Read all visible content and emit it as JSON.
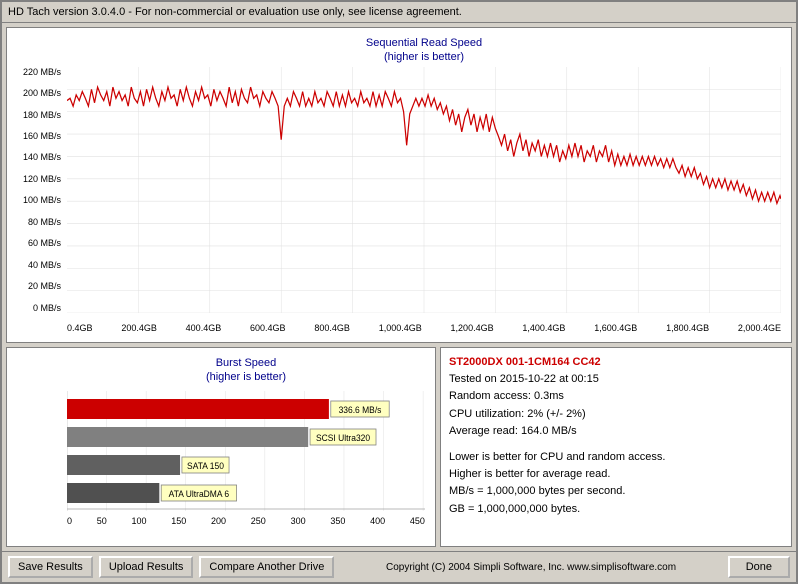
{
  "title_bar": {
    "text": "HD Tach version 3.0.4.0  - For non-commercial or evaluation use only, see license agreement."
  },
  "seq_chart": {
    "title_line1": "Sequential Read Speed",
    "title_line2": "(higher is better)",
    "y_labels": [
      "220 MB/s",
      "200 MB/s",
      "180 MB/s",
      "160 MB/s",
      "140 MB/s",
      "120 MB/s",
      "100 MB/s",
      "80 MB/s",
      "60 MB/s",
      "40 MB/s",
      "20 MB/s",
      "0 MB/s"
    ],
    "x_labels": [
      "0.4GB",
      "200.4GB",
      "400.4GB",
      "600.4GB",
      "800.4GB",
      "1,000.4GB",
      "1,200.4GB",
      "1,400.4GB",
      "1,600.4GB",
      "1,800.4GB",
      "2,000.4GE"
    ]
  },
  "burst_chart": {
    "title_line1": "Burst Speed",
    "title_line2": "(higher is better)",
    "bars": [
      {
        "label": "336.6 MB/s",
        "width_pct": 74,
        "color": "#cc0000",
        "label_pos": 75
      },
      {
        "label": "SCSI Ultra320",
        "width_pct": 68,
        "color": "#808080",
        "label_pos": 69
      },
      {
        "label": "SATA 150",
        "width_pct": 32,
        "color": "#606060",
        "label_pos": 33
      },
      {
        "label": "ATA UltraDMA 6",
        "width_pct": 26,
        "color": "#505050",
        "label_pos": 27
      }
    ],
    "x_labels": [
      "0",
      "50",
      "100",
      "150",
      "200",
      "250",
      "300",
      "350",
      "400",
      "450"
    ]
  },
  "info_panel": {
    "title": "ST2000DX 001-1CM164 CC42",
    "lines": [
      "Tested on 2015-10-22 at 00:15",
      "Random access: 0.3ms",
      "CPU utilization: 2% (+/- 2%)",
      "Average read: 164.0 MB/s",
      "",
      "Lower is better for CPU and random access.",
      "Higher is better for average read.",
      "MB/s = 1,000,000 bytes per second.",
      "GB = 1,000,000,000 bytes."
    ]
  },
  "toolbar": {
    "save_results": "Save Results",
    "upload_results": "Upload Results",
    "compare_drive": "Compare Another Drive",
    "copyright": "Copyright (C) 2004 Simpli Software, Inc. www.simplisoftware.com",
    "done": "Done"
  }
}
